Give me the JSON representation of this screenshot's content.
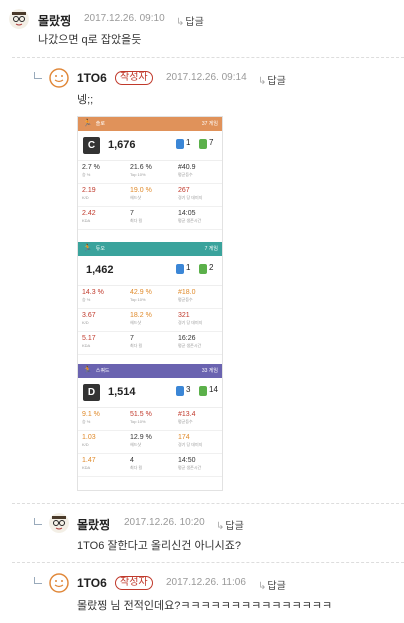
{
  "comments": [
    {
      "nick": "몰랐찡",
      "date": "2017.12.26. 09:10",
      "reply": "답글",
      "text": "나갔으면 q로 잡았을듯"
    },
    {
      "nick": "1TO6",
      "badge": "작성자",
      "date": "2017.12.26. 09:14",
      "reply": "답글",
      "text": "넹;;"
    },
    {
      "nick": "몰랐찡",
      "date": "2017.12.26. 10:20",
      "reply": "답글",
      "text": "1TO6 잘한다고 올리신건 아니시죠?"
    },
    {
      "nick": "1TO6",
      "badge": "작성자",
      "date": "2017.12.26. 11:06",
      "reply": "답글",
      "text_mention": "몰랐찡",
      "text": " 님 전적인데요?ㅋㅋㅋㅋㅋㅋㅋㅋㅋㅋㅋㅋㅋㅋㅋ"
    }
  ],
  "stats": {
    "sections": [
      {
        "title": "솔로",
        "count": "37 게임",
        "color": "#e0925a",
        "tier": "C",
        "mmr": "1,676",
        "chip_blue": "1",
        "chip_green": "7",
        "rows": [
          [
            {
              "v": "2.7 %",
              "l": "승 %",
              "c": "#333"
            },
            {
              "v": "21.6 %",
              "l": "Top 10%",
              "c": "#333"
            },
            {
              "v": "#40.9",
              "l": "평균등수",
              "c": "#333"
            }
          ],
          [
            {
              "v": "2.19",
              "l": "K/D",
              "c": "#c0392b"
            },
            {
              "v": "19.0 %",
              "l": "헤드샷",
              "c": "#e08a2a"
            },
            {
              "v": "267",
              "l": "경기 당 데미지",
              "c": "#c0392b"
            }
          ],
          [
            {
              "v": "2.42",
              "l": "KDA",
              "c": "#c0392b"
            },
            {
              "v": "7",
              "l": "최다 킬",
              "c": "#333"
            },
            {
              "v": "14:05",
              "l": "평균 생존시간",
              "c": "#333"
            }
          ]
        ]
      },
      {
        "title": "듀오",
        "count": "7 게임",
        "color": "#3aa39c",
        "tier": "",
        "mmr": "1,462",
        "chip_blue": "1",
        "chip_green": "2",
        "rows": [
          [
            {
              "v": "14.3 %",
              "l": "승 %",
              "c": "#c0392b"
            },
            {
              "v": "42.9 %",
              "l": "Top 10%",
              "c": "#e08a2a"
            },
            {
              "v": "#18.0",
              "l": "평균등수",
              "c": "#e08a2a"
            }
          ],
          [
            {
              "v": "3.67",
              "l": "K/D",
              "c": "#c0392b"
            },
            {
              "v": "18.2 %",
              "l": "헤드샷",
              "c": "#e08a2a"
            },
            {
              "v": "321",
              "l": "경기 당 데미지",
              "c": "#c0392b"
            }
          ],
          [
            {
              "v": "5.17",
              "l": "KDA",
              "c": "#c0392b"
            },
            {
              "v": "7",
              "l": "최다 킬",
              "c": "#333"
            },
            {
              "v": "16:26",
              "l": "평균 생존시간",
              "c": "#333"
            }
          ]
        ]
      },
      {
        "title": "스쿼드",
        "count": "33 게임",
        "color": "#6a63b0",
        "tier": "D",
        "mmr": "1,514",
        "chip_blue": "3",
        "chip_green": "14",
        "rows": [
          [
            {
              "v": "9.1 %",
              "l": "승 %",
              "c": "#e08a2a"
            },
            {
              "v": "51.5 %",
              "l": "Top 10%",
              "c": "#c0392b"
            },
            {
              "v": "#13.4",
              "l": "평균등수",
              "c": "#c0392b"
            }
          ],
          [
            {
              "v": "1.03",
              "l": "K/D",
              "c": "#e08a2a"
            },
            {
              "v": "12.9 %",
              "l": "헤드샷",
              "c": "#333"
            },
            {
              "v": "174",
              "l": "경기 당 데미지",
              "c": "#e08a2a"
            }
          ],
          [
            {
              "v": "1.47",
              "l": "KDA",
              "c": "#e08a2a"
            },
            {
              "v": "4",
              "l": "최다 킬",
              "c": "#333"
            },
            {
              "v": "14:50",
              "l": "평균 생존시간",
              "c": "#333"
            }
          ]
        ]
      }
    ]
  }
}
